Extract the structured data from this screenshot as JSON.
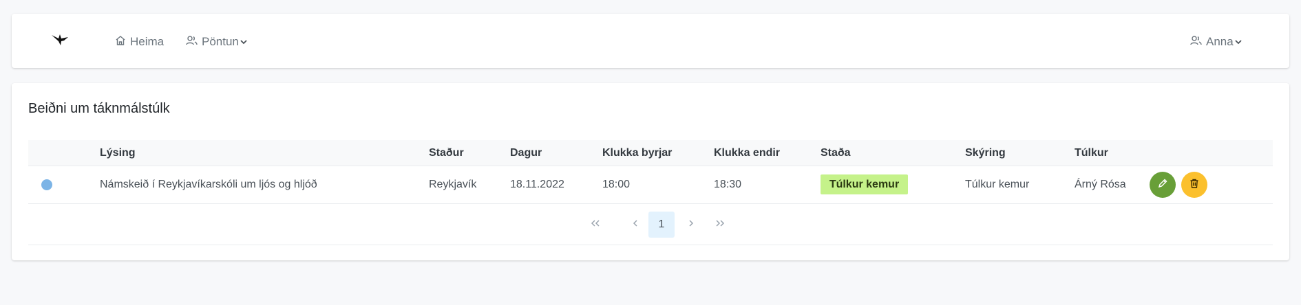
{
  "nav": {
    "home_label": "Heima",
    "order_label": "Pöntun",
    "user_label": "Anna"
  },
  "page": {
    "title": "Beiðni um táknmálstúlk"
  },
  "table": {
    "columns": [
      "Lýsing",
      "Staður",
      "Dagur",
      "Klukka byrjar",
      "Klukka endir",
      "Staða",
      "Skýring",
      "Túlkur"
    ],
    "rows": [
      {
        "indicator_color": "#7cb4e6",
        "description": "Námskeið í Reykjavíkarskóli um ljós og hljóð",
        "place": "Reykjavík",
        "date": "18.11.2022",
        "start": "18:00",
        "end": "18:30",
        "status": "Túlkur kemur",
        "explanation": "Túlkur kemur",
        "interpreter": "Árný Rósa"
      }
    ]
  },
  "pagination": {
    "current_page": "1"
  },
  "colors": {
    "status_badge": "#c5f28a",
    "edit_button": "#689f38",
    "delete_button": "#fbc02d",
    "current_page_bg": "#e3f2fd"
  },
  "icons": {
    "logo": "bird-logo-icon",
    "home": "home-icon",
    "users": "users-icon",
    "chevron": "chevron-down-icon",
    "edit": "pencil-icon",
    "delete": "trash-icon",
    "first": "double-chevron-left-icon",
    "prev": "chevron-left-icon",
    "next": "chevron-right-icon",
    "last": "double-chevron-right-icon"
  }
}
